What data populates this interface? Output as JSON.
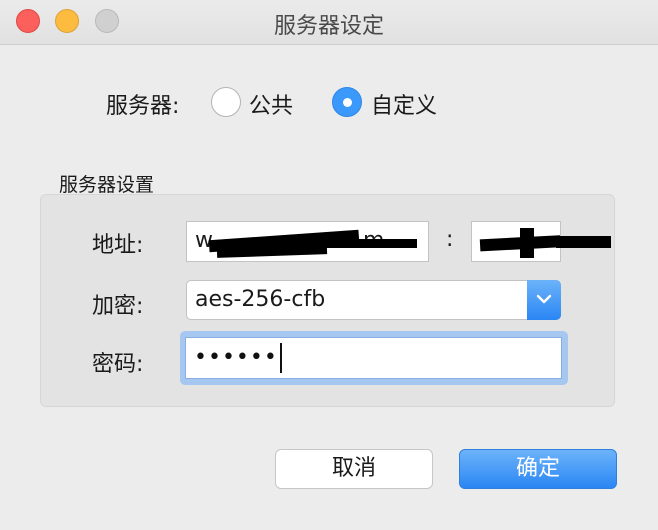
{
  "window": {
    "title": "服务器设定"
  },
  "server_type": {
    "label": "服务器:",
    "options": [
      {
        "label": "公共",
        "selected": false
      },
      {
        "label": "自定义",
        "selected": true
      }
    ]
  },
  "settings": {
    "group_title": "服务器设置",
    "address_label": "地址:",
    "address_value": "w",
    "address_value_tail": "m",
    "port_separator": ":",
    "encryption_label": "加密:",
    "encryption_value": "aes-256-cfb",
    "password_label": "密码:",
    "password_mask": "••••••"
  },
  "buttons": {
    "cancel": "取消",
    "confirm": "确定"
  },
  "colors": {
    "accent": "#3b99fc",
    "close": "#fc605c",
    "minimize": "#fdbc40",
    "maximize_disabled": "#d0d0d0"
  }
}
